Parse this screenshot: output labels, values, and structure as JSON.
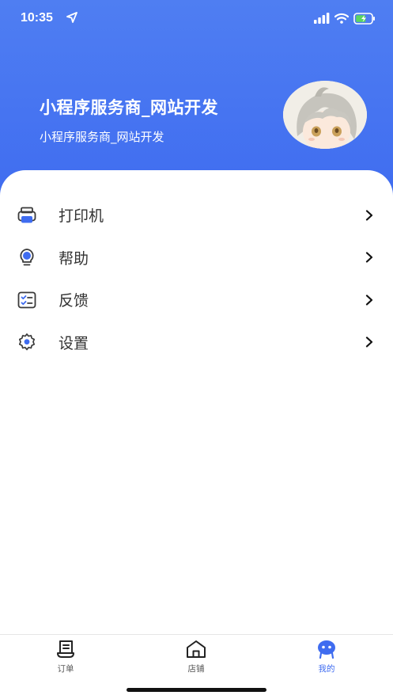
{
  "status_bar": {
    "time": "10:35"
  },
  "profile": {
    "title": "小程序服务商_网站开发",
    "subtitle": "小程序服务商_网站开发"
  },
  "menu": {
    "items": [
      {
        "label": "打印机",
        "icon": "printer-icon"
      },
      {
        "label": "帮助",
        "icon": "lightbulb-icon"
      },
      {
        "label": "反馈",
        "icon": "feedback-icon"
      },
      {
        "label": "设置",
        "icon": "gear-icon"
      }
    ]
  },
  "tabbar": {
    "items": [
      {
        "label": "订单",
        "icon": "order-icon"
      },
      {
        "label": "店铺",
        "icon": "store-icon"
      },
      {
        "label": "我的",
        "icon": "profile-icon",
        "active": true
      }
    ]
  },
  "colors": {
    "accent": "#3f6cf0",
    "header_bg": "#4f7ef2"
  }
}
